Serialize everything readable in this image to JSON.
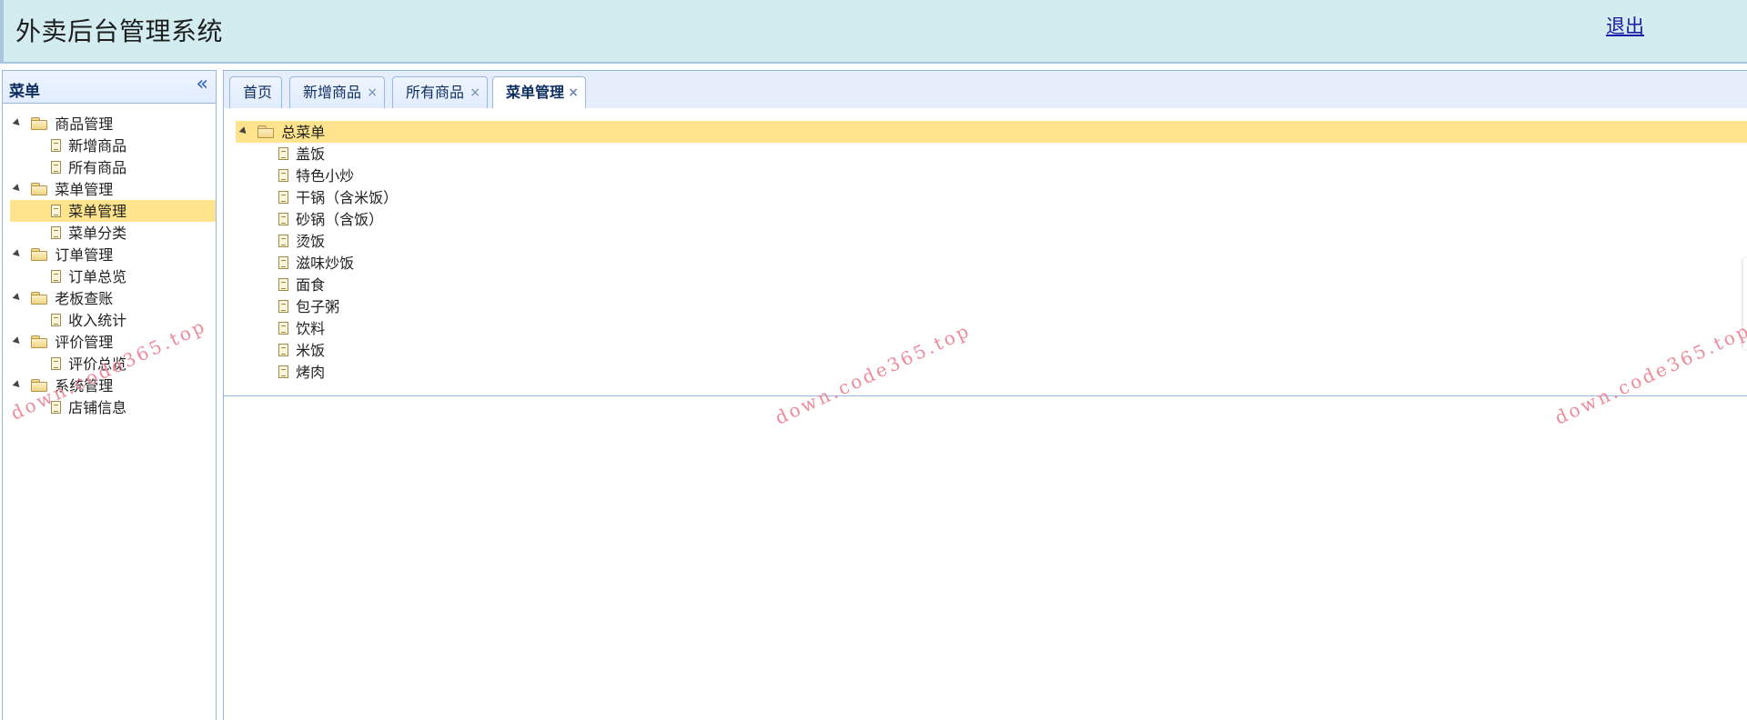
{
  "header": {
    "title": "外卖后台管理系统",
    "logout_label": "退出"
  },
  "sidebar": {
    "title": "菜单",
    "collapse_icon": "double-chevron-left-icon",
    "groups": [
      {
        "label": "商品管理",
        "items": [
          {
            "label": "新增商品"
          },
          {
            "label": "所有商品"
          }
        ]
      },
      {
        "label": "菜单管理",
        "items": [
          {
            "label": "菜单管理",
            "selected": true
          },
          {
            "label": "菜单分类"
          }
        ]
      },
      {
        "label": "订单管理",
        "items": [
          {
            "label": "订单总览"
          }
        ]
      },
      {
        "label": "老板查账",
        "items": [
          {
            "label": "收入统计"
          }
        ]
      },
      {
        "label": "评价管理",
        "items": [
          {
            "label": "评价总览"
          }
        ]
      },
      {
        "label": "系统管理",
        "items": [
          {
            "label": "店铺信息"
          }
        ]
      }
    ]
  },
  "tabs": [
    {
      "label": "首页",
      "closable": false
    },
    {
      "label": "新增商品",
      "closable": true
    },
    {
      "label": "所有商品",
      "closable": true
    },
    {
      "label": "菜单管理",
      "closable": true,
      "active": true
    }
  ],
  "tab_close_glyph": "×",
  "menu_tree": {
    "root_label": "总菜单",
    "items": [
      "盖饭",
      "特色小炒",
      "干锅（含米饭）",
      "砂锅（含饭）",
      "烫饭",
      "滋味炒饭",
      "面食",
      "包子粥",
      "饮料",
      "米饭",
      "烤肉"
    ]
  },
  "watermark": "down.code365.top",
  "colors": {
    "header_bg": "#d2ecf0",
    "selected_bg": "#ffe48d",
    "panel_border": "#95b8e7",
    "logout_link": "#1a1aa8",
    "watermark": "#ef8a9a"
  }
}
